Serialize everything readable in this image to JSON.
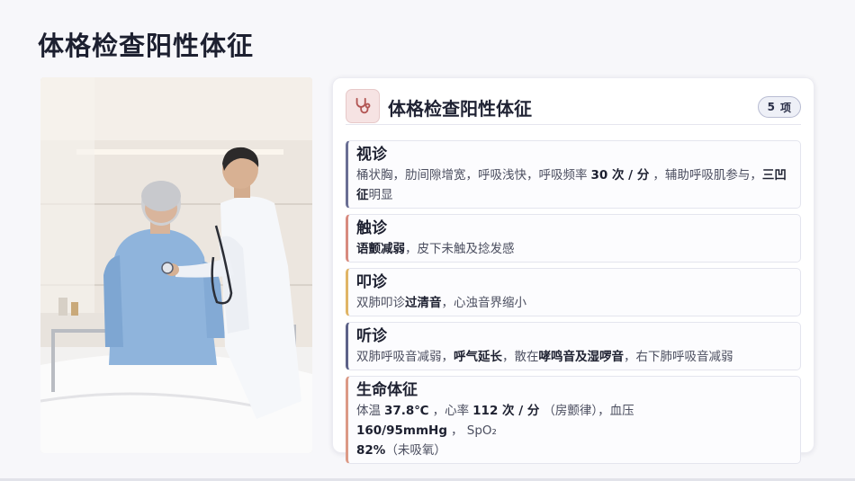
{
  "page": {
    "title": "体格检查阳性体征"
  },
  "photo": {
    "alt": ""
  },
  "card": {
    "icon": "stethoscope-icon",
    "title": "体格检查阳性体征",
    "badge": {
      "count": "5",
      "unit": "项"
    }
  },
  "exam": {
    "inspection": {
      "title": "视诊",
      "t1": "桶状胸，肋间隙增宽，呼吸浅快，呼吸频率",
      "b1": "30 次 / 分",
      "t2": "，辅助呼吸肌参与，",
      "b2": "三凹征",
      "t3": "明显"
    },
    "palpation": {
      "title": "触诊",
      "b1": "语颤减弱",
      "t1": "，皮下未触及捻发感"
    },
    "percussion": {
      "title": "叩诊",
      "t1": "双肺叩诊",
      "b1": "过清音",
      "t2": "，心浊音界缩小"
    },
    "auscultation": {
      "title": "听诊",
      "t1": "双肺呼吸音减弱，",
      "b1": "呼气延长",
      "t2": "，散在",
      "b2": "哮鸣音及湿啰音",
      "t3": "，右下肺呼吸音减弱"
    },
    "vitals": {
      "title": "生命体征",
      "t1": "体温",
      "b1": "37.8℃",
      "t2": "，心率",
      "b2": "112 次 / 分",
      "t3": "（房颤律），血压",
      "b3": "160/95mmHg",
      "t4": "， SpO₂",
      "b4": "82%",
      "t5": "（未吸氧）"
    }
  },
  "colors": {
    "inspection": "#6b6f8e",
    "palpation": "#d88b7f",
    "percussion": "#e0b566",
    "auscultation": "#5d6288",
    "vitals": "#dc9a86"
  }
}
